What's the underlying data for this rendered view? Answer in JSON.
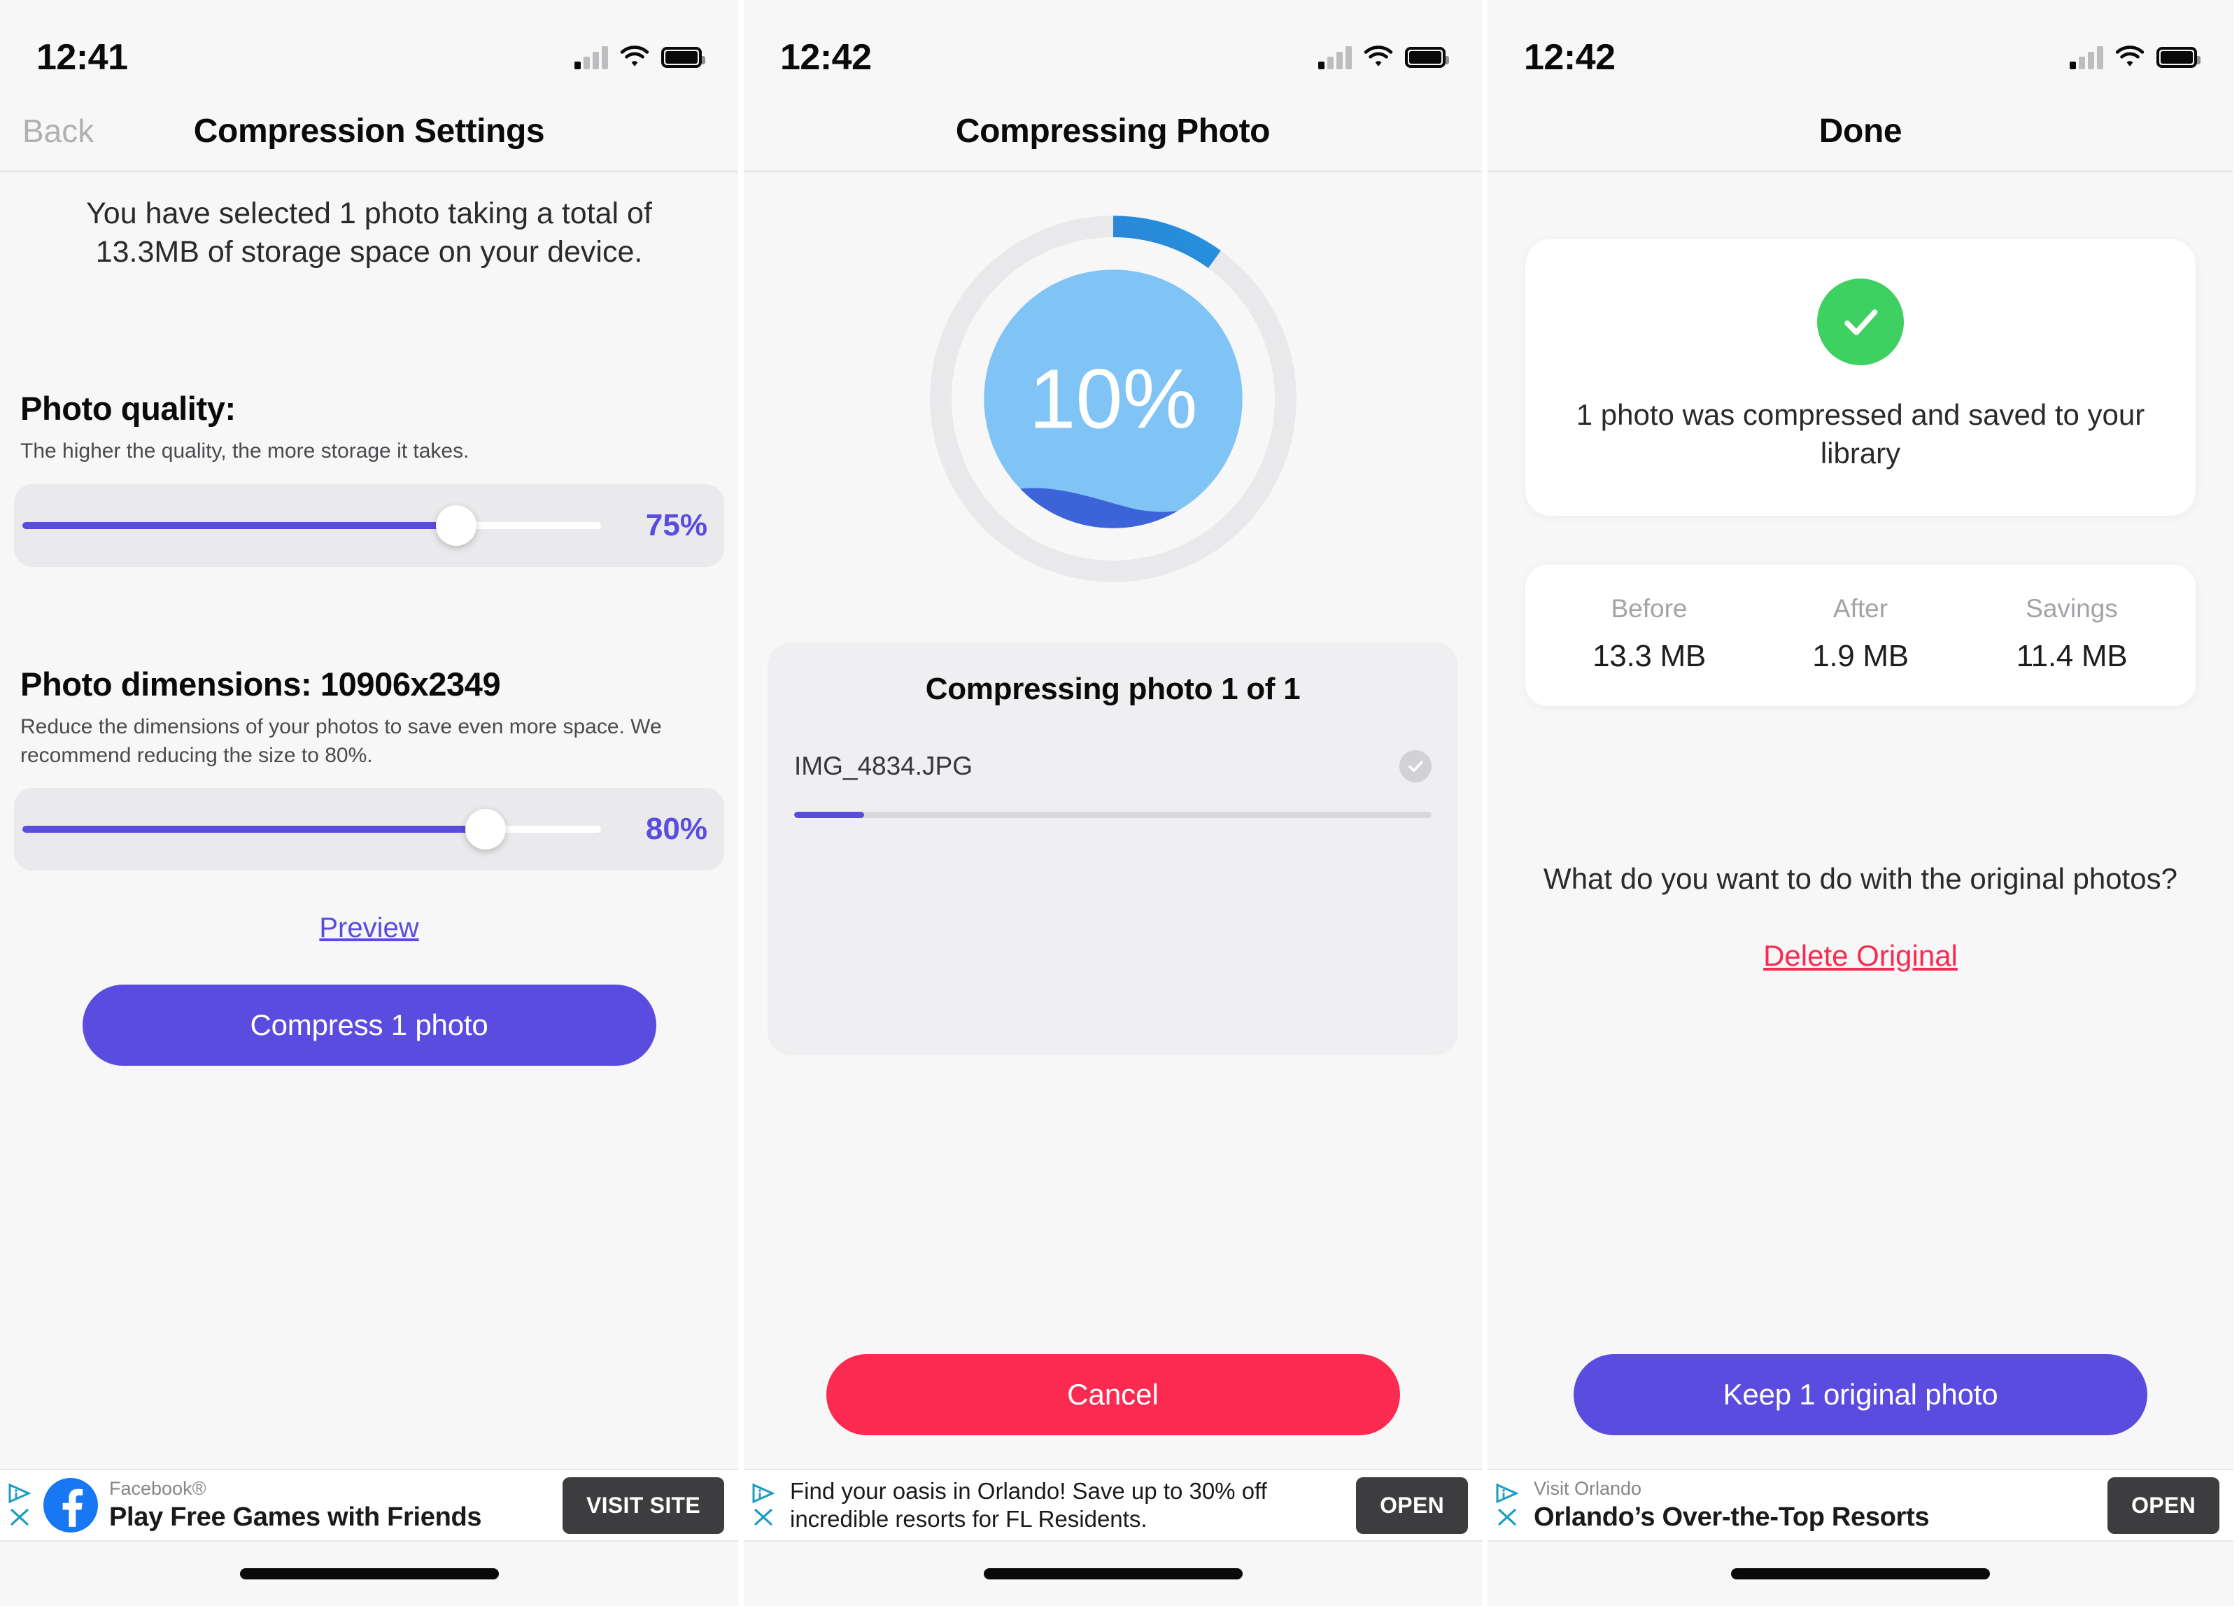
{
  "screens": [
    {
      "status": {
        "time": "12:41",
        "signal_icon": "cellular-bars-icon",
        "wifi_icon": "wifi-icon",
        "battery_icon": "battery-full-icon"
      },
      "nav": {
        "back_label": "Back",
        "title": "Compression Settings"
      },
      "intro": "You have selected 1 photo taking a total of 13.3MB of storage space on your device.",
      "quality": {
        "heading": "Photo quality:",
        "subtext": "The higher the quality, the more storage it takes.",
        "value_label": "75%",
        "percent": 75
      },
      "dimensions": {
        "heading": "Photo dimensions: 10906x2349",
        "subtext": "Reduce the dimensions of your photos to save even more space. We recommend reducing the size to 80%.",
        "value_label": "80%",
        "percent": 80
      },
      "preview_label": "Preview",
      "primary_button": "Compress 1 photo",
      "ad": {
        "advertiser": "Facebook®",
        "headline": "Play Free Games with Friends",
        "cta": "VISIT SITE",
        "brand_icon": "facebook-logo-icon",
        "adchoices_icon": "adchoices-icon",
        "close_icon": "close-x-icon"
      }
    },
    {
      "status": {
        "time": "12:42",
        "signal_icon": "cellular-bars-icon",
        "wifi_icon": "wifi-icon",
        "battery_icon": "battery-full-icon"
      },
      "nav": {
        "title": "Compressing Photo"
      },
      "progress": {
        "percent_label": "10%",
        "percent": 10
      },
      "card": {
        "title": "Compressing photo 1 of 1",
        "file_name": "IMG_4834.JPG",
        "file_progress_percent": 11,
        "check_icon": "check-circle-icon"
      },
      "cancel_button": "Cancel",
      "ad": {
        "body": "Find your oasis in Orlando! Save up to 30% off incredible resorts for FL Residents.",
        "cta": "OPEN",
        "adchoices_icon": "adchoices-icon",
        "close_icon": "close-x-icon"
      }
    },
    {
      "status": {
        "time": "12:42",
        "signal_icon": "cellular-bars-icon",
        "wifi_icon": "wifi-icon",
        "battery_icon": "battery-full-icon"
      },
      "nav": {
        "title": "Done"
      },
      "result": {
        "icon": "success-check-icon",
        "message": "1 photo was compressed and saved to your library"
      },
      "stats": [
        {
          "label": "Before",
          "value": "13.3 MB"
        },
        {
          "label": "After",
          "value": "1.9 MB"
        },
        {
          "label": "Savings",
          "value": "11.4 MB"
        }
      ],
      "question": "What do you want to do with the original photos?",
      "delete_link": "Delete Original",
      "primary_button": "Keep 1 original photo",
      "ad": {
        "advertiser": "Visit Orlando",
        "headline": "Orlando’s Over-the-Top Resorts",
        "cta": "OPEN",
        "adchoices_icon": "adchoices-icon",
        "close_icon": "close-x-icon"
      }
    }
  ],
  "colors": {
    "accent_purple": "#5b4ce0",
    "danger_red": "#fa2a50",
    "success_green": "#3ed060",
    "ring_track": "#e8e8ea",
    "bubble_blue": "#7fc4f5",
    "wave_blue": "#3d63d8"
  }
}
